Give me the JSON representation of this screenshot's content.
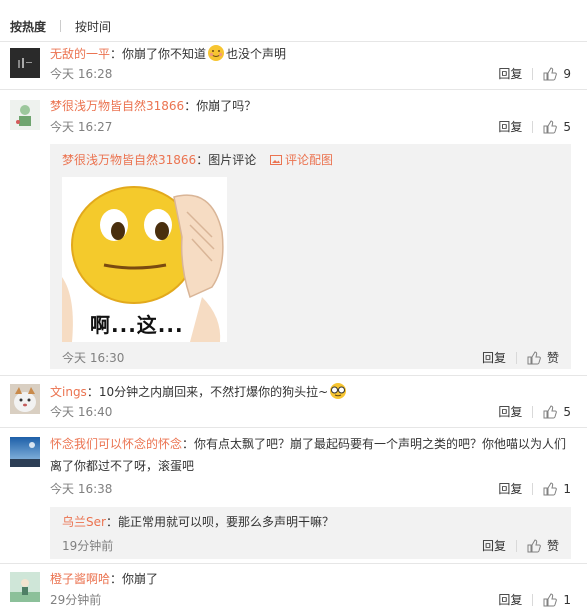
{
  "sort_tabs": {
    "hot": "按热度",
    "time": "按时间"
  },
  "actions": {
    "reply": "回复",
    "like": "赞"
  },
  "comments": [
    {
      "user": "无敌的一平",
      "text_before": "：你崩了你不知道",
      "text_after": "也没个声明",
      "time": "今天 16:28",
      "likes": "9"
    },
    {
      "user": "梦很浅万物皆自然31866",
      "text": "：你崩了吗？",
      "time": "今天 16:27",
      "likes": "5",
      "sub": {
        "user": "梦很浅万物皆自然31866",
        "text": "：图片评论",
        "pic_link": "评论配图",
        "sticker_caption": "啊...这...",
        "time": "今天 16:30"
      }
    },
    {
      "user": "文ings",
      "text": "：10分钟之内崩回来，不然打爆你的狗头拉~",
      "time": "今天 16:40",
      "likes": "5"
    },
    {
      "user": "怀念我们可以怀念的怀念",
      "text": "：你有点太飘了吧？崩了最起码要有一个声明之类的吧？你他喵以为人们离了你都过不了呀，滚蛋吧",
      "time": "今天 16:38",
      "likes": "1",
      "sub": {
        "user": "乌兰Ser",
        "text": "：能正常用就可以呗，要那么多声明干嘛？",
        "time": "19分钟前"
      }
    },
    {
      "user": "橙子酱啊哈",
      "text": "：你崩了",
      "time": "29分钟前",
      "likes": "1"
    }
  ]
}
